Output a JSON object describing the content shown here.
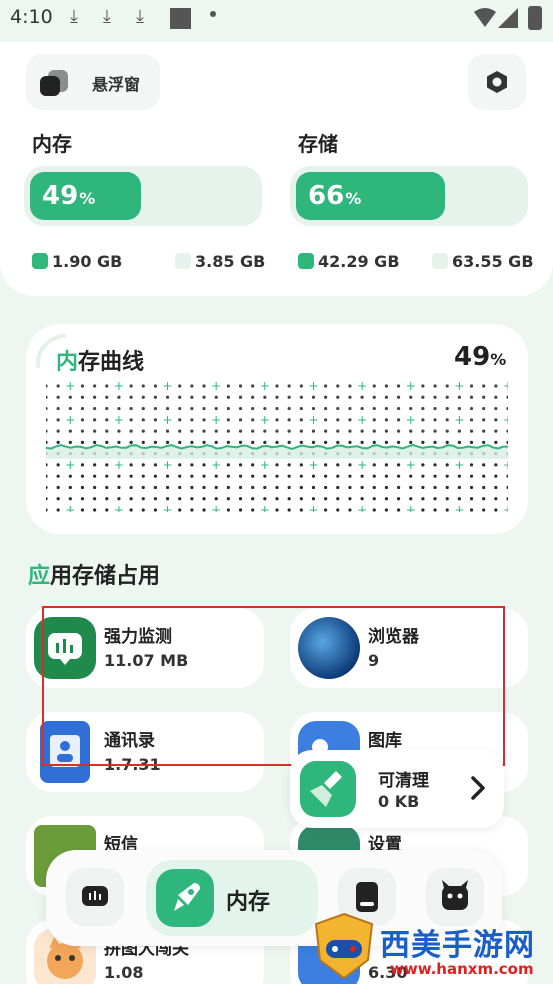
{
  "status_bar": {
    "time": "4:10",
    "download_icon": "download-arrow"
  },
  "top_bar": {
    "float_window_label": "悬浮窗"
  },
  "memory": {
    "label": "内存",
    "percent": "49",
    "percent_sign": "%",
    "fill": 0.49,
    "used": "1.90 GB",
    "total": "3.85 GB"
  },
  "storage": {
    "label": "存储",
    "percent": "66",
    "percent_sign": "%",
    "fill": 0.66,
    "used": "42.29 GB",
    "total": "63.55 GB"
  },
  "memory_curve": {
    "title_first": "内",
    "title_rest": "存曲线",
    "percent": "49",
    "percent_sign": "%"
  },
  "apps_section": {
    "title_first": "应",
    "title_rest": "用存储占用",
    "apps": [
      {
        "name": "强力监测",
        "size": "11.07 MB",
        "icon": "monitor-app-icon"
      },
      {
        "name": "浏览器",
        "size": "9",
        "icon": "browser-globe-icon"
      },
      {
        "name": "通讯录",
        "size": "1.7.31",
        "icon": "contacts-icon"
      },
      {
        "name": "图库",
        "size": "",
        "icon": "gallery-icon"
      },
      {
        "name": "短信",
        "size": "",
        "icon": "sms-icon"
      },
      {
        "name": "设置",
        "size": "",
        "icon": "settings-app-icon"
      },
      {
        "name": "拼图大闯关",
        "size": "1.08",
        "icon": "puzzle-game-icon"
      },
      {
        "name": "",
        "size": "6.30",
        "icon": "app-icon"
      }
    ]
  },
  "clean_card": {
    "label": "可清理",
    "size": "0 KB"
  },
  "bottom_nav": {
    "active_label": "内存"
  },
  "watermark": {
    "title": "西美手游网",
    "url": "www.hanxm.com"
  },
  "colors": {
    "accent": "#2eb67d",
    "accent_light": "#e5f3ec",
    "highlight_box": "#e02b2b"
  }
}
